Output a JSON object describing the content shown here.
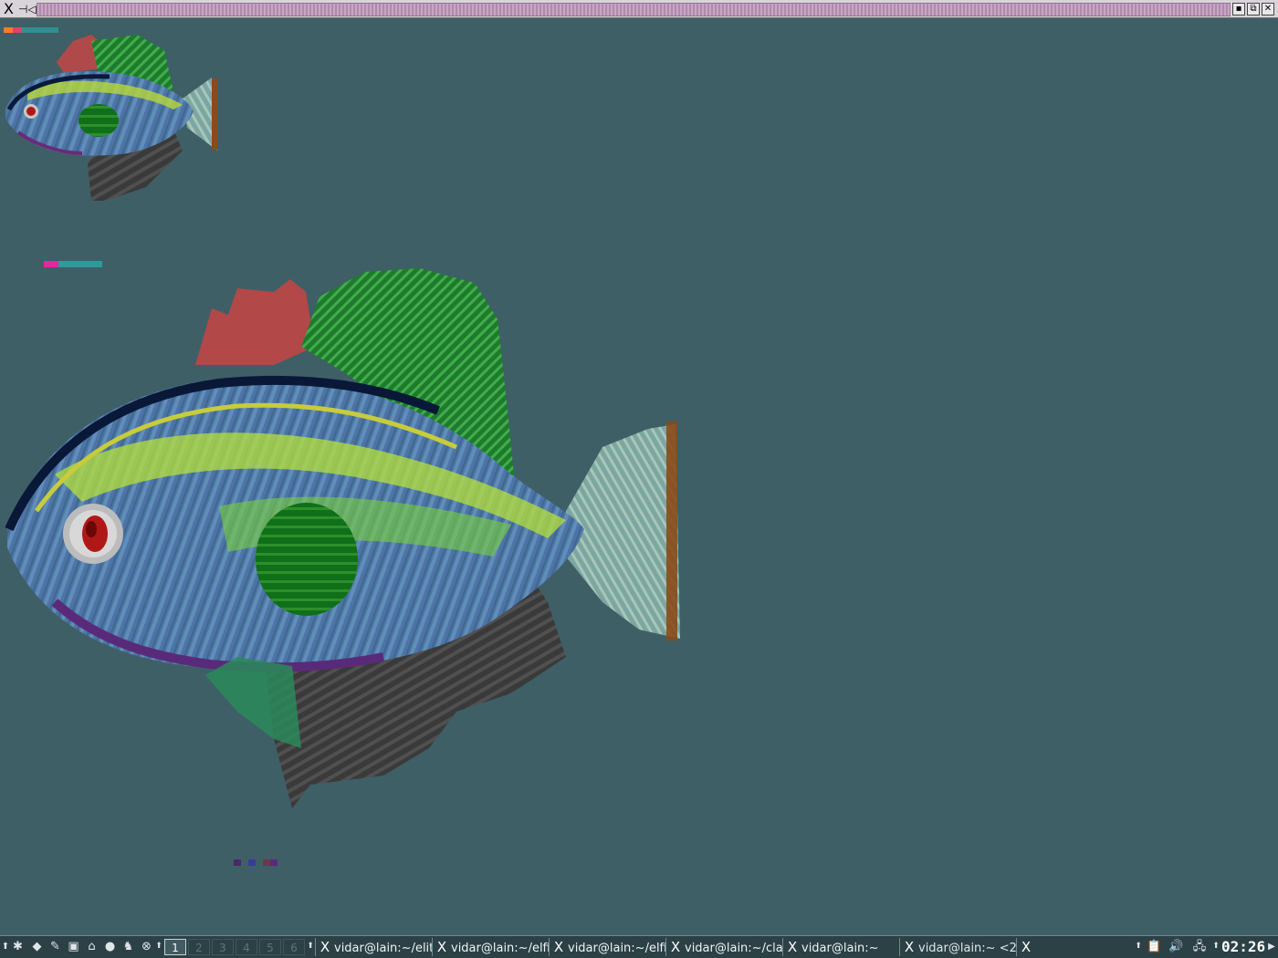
{
  "window": {
    "title_glyph": "X",
    "pin_glyph": "⊣◁",
    "buttons": {
      "minimize": "▪",
      "maximize": "⧉",
      "close": "✕"
    }
  },
  "desktop": {
    "background_color": "#3f5f66",
    "images": [
      {
        "name": "small-fish-image",
        "subject": "pixelated fish"
      },
      {
        "name": "large-fish-image",
        "subject": "pixelated fish"
      }
    ]
  },
  "taskbar": {
    "launcher_icons": [
      "start-menu-icon",
      "terminal-icon",
      "editor-icon",
      "window-icon",
      "home-icon",
      "browser-icon",
      "game-icon",
      "lifebuoy-icon"
    ],
    "workspaces": [
      {
        "label": "1",
        "active": true
      },
      {
        "label": "2",
        "active": false
      },
      {
        "label": "3",
        "active": false
      },
      {
        "label": "4",
        "active": false
      },
      {
        "label": "5",
        "active": false
      },
      {
        "label": "6",
        "active": false
      }
    ],
    "tasks": [
      {
        "icon": "X",
        "label": "vidar@lain:~/elit"
      },
      {
        "icon": "X",
        "label": "vidar@lain:~/elfi"
      },
      {
        "icon": "X",
        "label": "vidar@lain:~/elfi"
      },
      {
        "icon": "X",
        "label": "vidar@lain:~/cla"
      },
      {
        "icon": "X",
        "label": "vidar@lain:~"
      },
      {
        "icon": "X",
        "label": "vidar@lain:~ <2"
      },
      {
        "icon": "X",
        "label": ""
      }
    ],
    "tray_icons": [
      "clipboard-icon",
      "volume-icon",
      "network-icon"
    ],
    "clock": "02:26"
  }
}
